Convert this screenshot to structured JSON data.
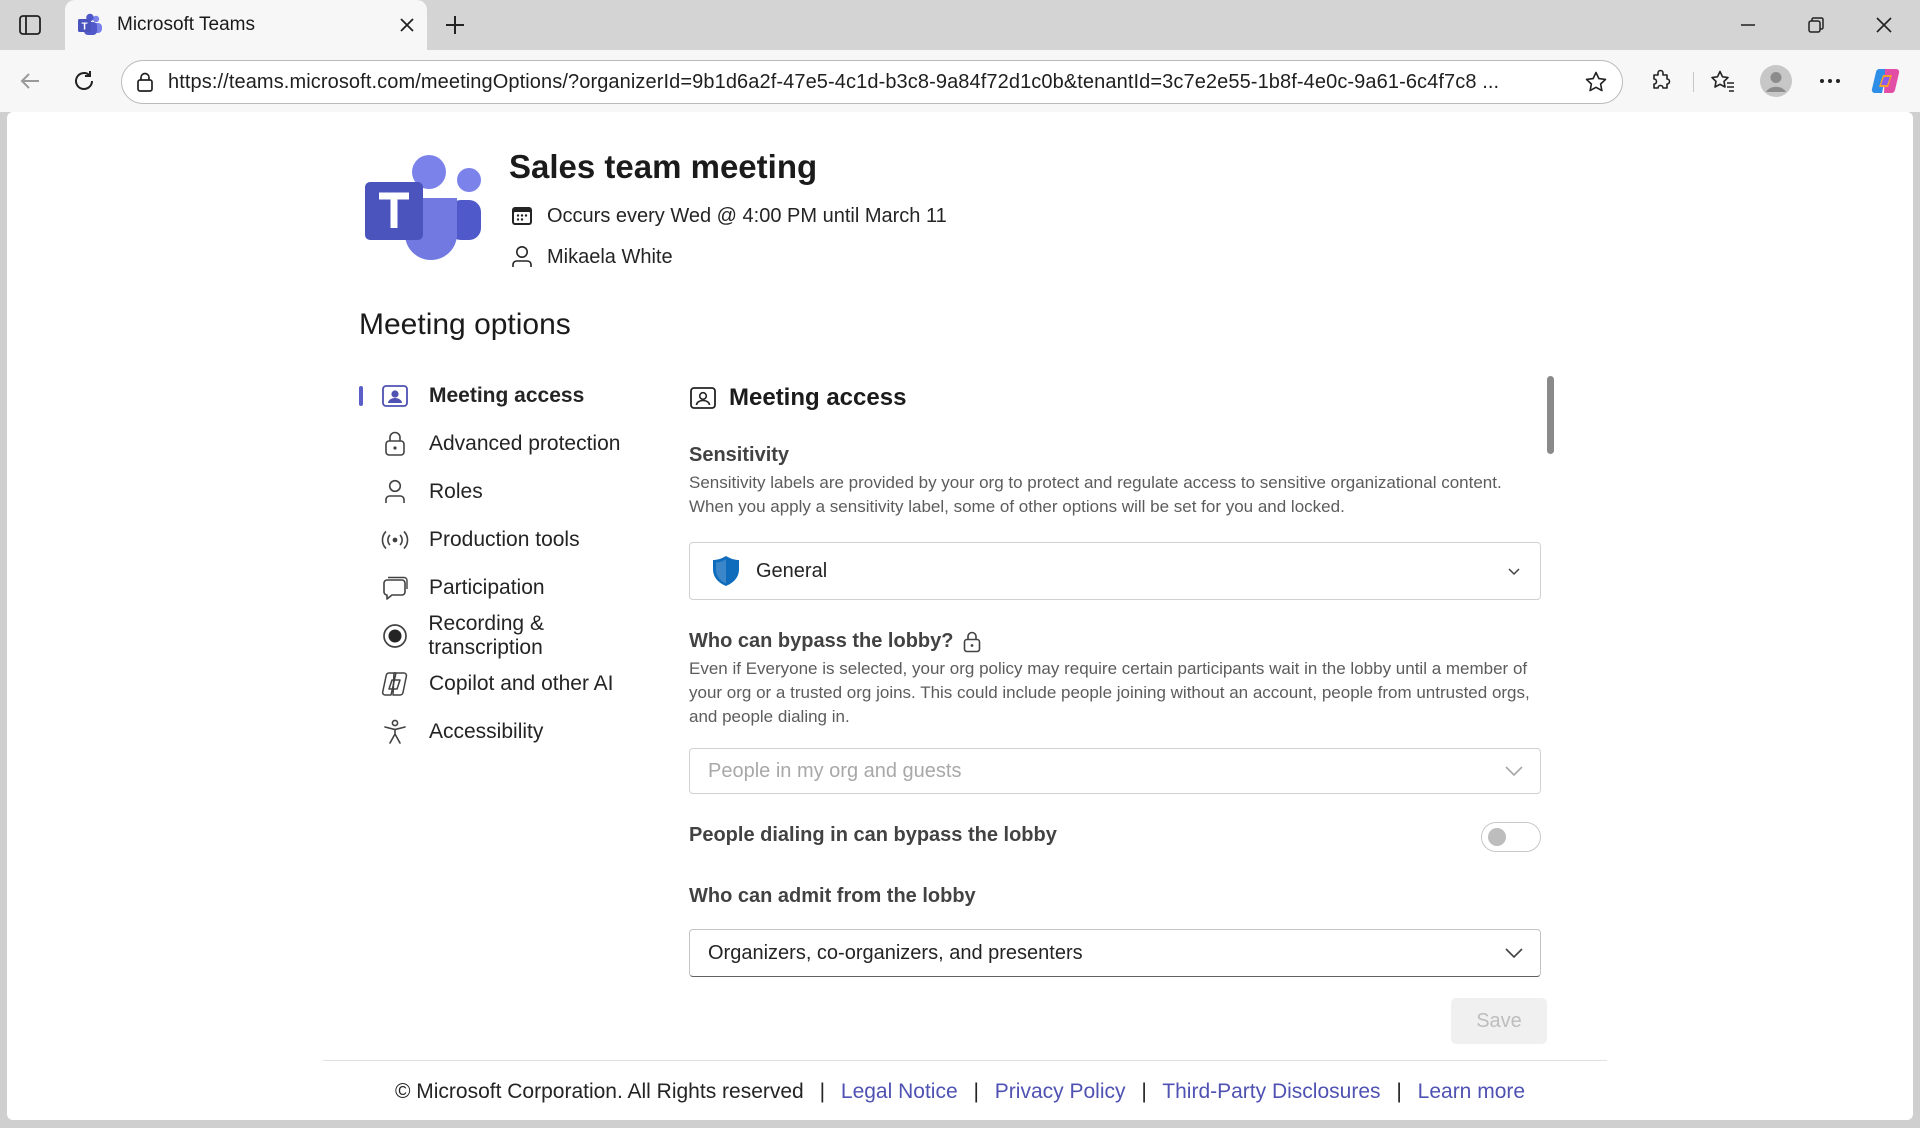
{
  "browser": {
    "tab_title": "Microsoft Teams",
    "url": "https://teams.microsoft.com/meetingOptions/?organizerId=9b1d6a2f-47e5-4c1d-b3c8-9a84f72d1c0b&tenantId=3c7e2e55-1b8f-4e0c-9a61-6c4f7c8 ..."
  },
  "meeting": {
    "title": "Sales team meeting",
    "schedule": "Occurs every Wed @ 4:00 PM until March 11",
    "organizer": "Mikaela White"
  },
  "page": {
    "heading": "Meeting options"
  },
  "nav": {
    "items": [
      {
        "label": "Meeting access",
        "icon": "meeting-access-icon"
      },
      {
        "label": "Advanced protection",
        "icon": "lock-icon"
      },
      {
        "label": "Roles",
        "icon": "person-icon"
      },
      {
        "label": "Production tools",
        "icon": "broadcast-icon"
      },
      {
        "label": "Participation",
        "icon": "chat-icon"
      },
      {
        "label": "Recording & transcription",
        "icon": "record-icon"
      },
      {
        "label": "Copilot and other AI",
        "icon": "copilot-icon"
      },
      {
        "label": "Accessibility",
        "icon": "accessibility-icon"
      }
    ]
  },
  "panel": {
    "title": "Meeting access",
    "sensitivity": {
      "label": "Sensitivity",
      "description": "Sensitivity labels are provided by your org to protect and regulate access to sensitive organizational content. When you apply a sensitivity label, some of other options will be set for you and locked.",
      "value": "General"
    },
    "bypass": {
      "label": "Who can bypass the lobby?",
      "description": "Even if Everyone is selected, your org policy may require certain participants wait in the lobby until a member of your org or a trusted org joins. This could include people joining without an account, people from untrusted orgs, and people dialing in.",
      "value": "People in my org and guests"
    },
    "dialin": {
      "label": "People dialing in can bypass the lobby",
      "enabled": false
    },
    "admit": {
      "label": "Who can admit from the lobby",
      "value": "Organizers, co-organizers, and presenters"
    },
    "save_label": "Save"
  },
  "footer": {
    "copyright": "© Microsoft Corporation. All Rights reserved",
    "links": [
      "Legal Notice",
      "Privacy Policy",
      "Third-Party Disclosures",
      "Learn more"
    ],
    "separator": "|"
  },
  "colors": {
    "accent": "#5b5fc7",
    "link": "#4f52b2",
    "shield": "#0f6cbd"
  }
}
